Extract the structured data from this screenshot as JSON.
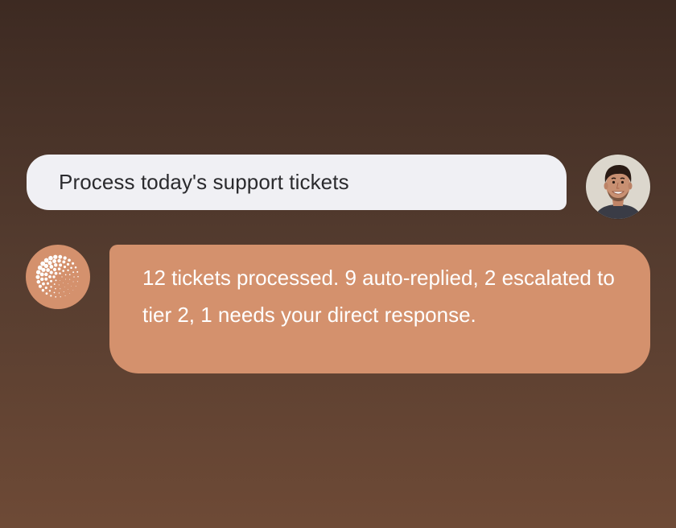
{
  "conversation": {
    "user_message": {
      "text": "Process today's support tickets",
      "avatar_icon": "user-avatar-photo"
    },
    "assistant_message": {
      "text": "12 tickets processed. 9 auto-replied, 2 escalated to tier 2, 1 needs your direct response.",
      "avatar_icon": "dot-burst-logo-icon"
    }
  },
  "colors": {
    "background_top": "#3d2a22",
    "background_bottom": "#6e4a36",
    "user_bubble": "#f0f0f4",
    "assistant_bubble": "#d4916d",
    "assistant_text": "#ffffff",
    "user_text": "#2b2b2e"
  }
}
